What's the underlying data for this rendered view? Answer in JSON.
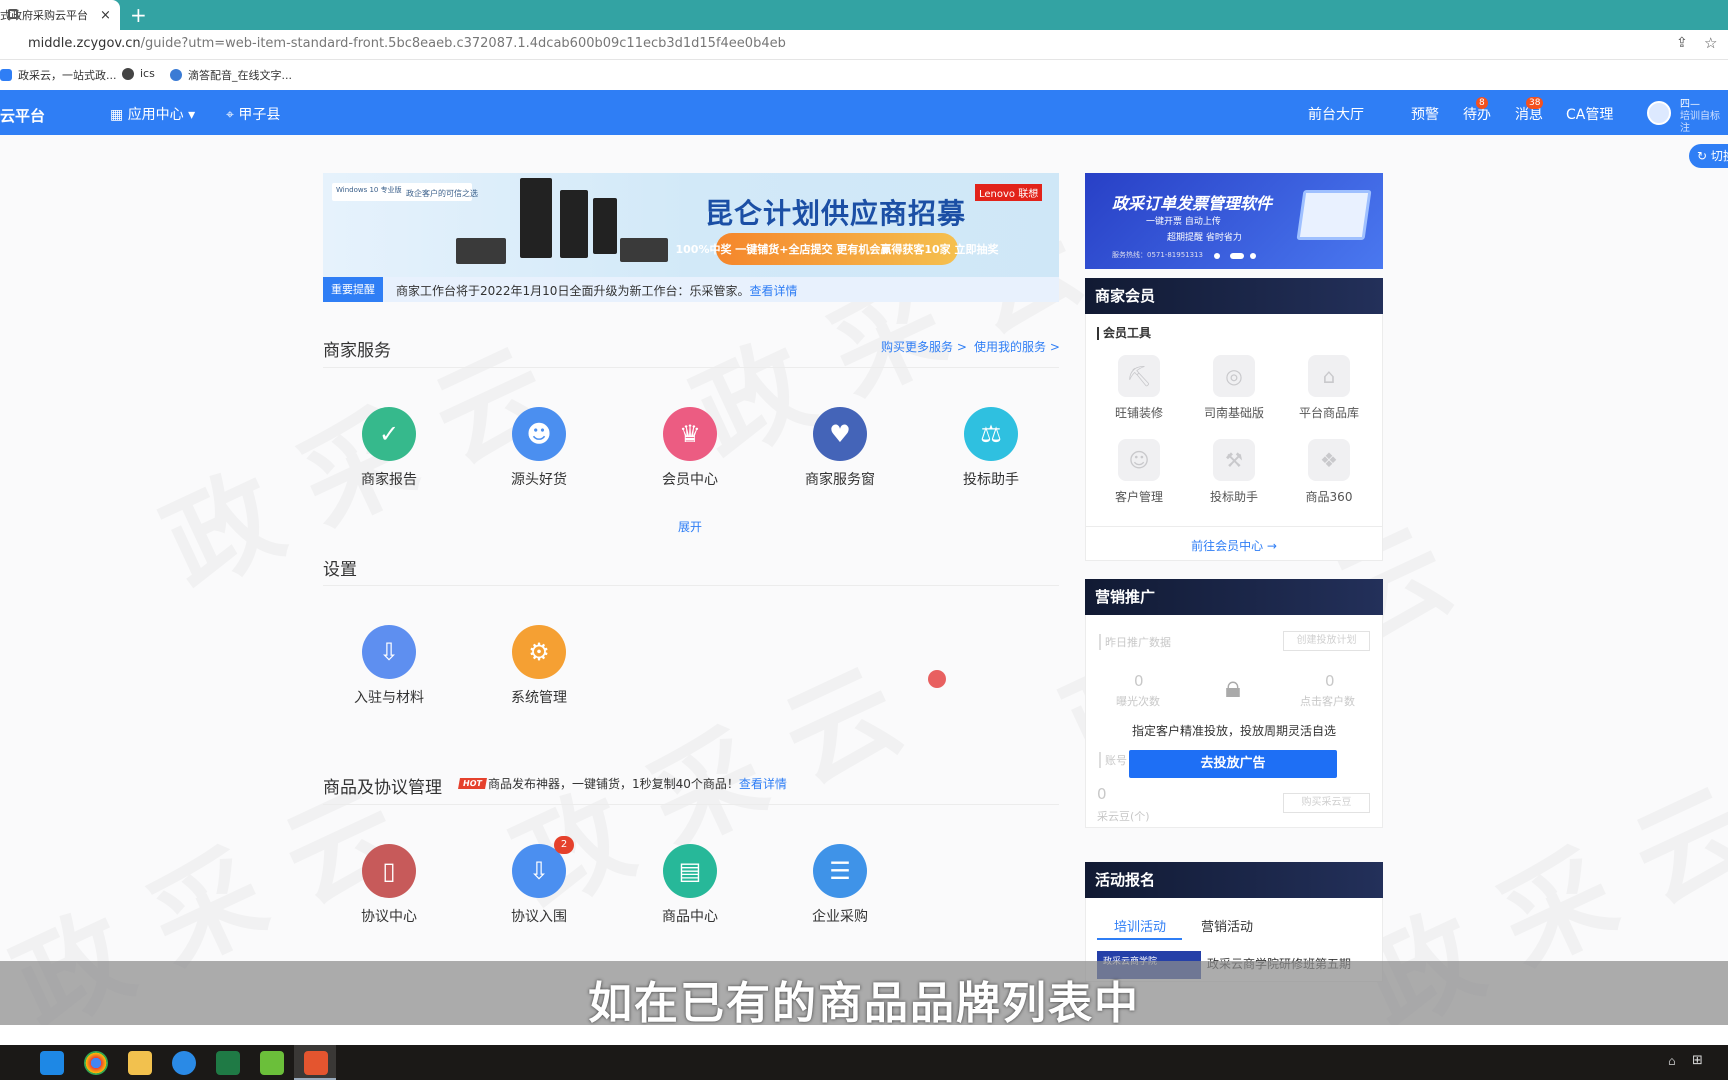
{
  "browser": {
    "tab_title": "式政府采购云平台",
    "tab_close": "×",
    "new_tab": "+",
    "url_host": "middle.zcygov.cn",
    "url_path": "/guide?utm=web-item-standard-front.5bc8eaeb.c372087.1.4dcab600b09c11ecb3d1d15f4ee0b4eb",
    "bookmarks": [
      "政采云，一站式政...",
      "ics",
      "滴答配音_在线文字..."
    ]
  },
  "header": {
    "brand": "云平台",
    "app_center": "应用中心",
    "location": "甲子县",
    "nav": {
      "front_hall": "前台大厅",
      "alert": "预警",
      "todo": "待办",
      "todo_badge": "8",
      "messages": "消息",
      "messages_badge": "38",
      "ca": "CA管理"
    },
    "user_name": "四—",
    "user_sub": "培训自标注",
    "switch": "切换"
  },
  "banner": {
    "logo_text": "Windows 10 专业版",
    "sub": "政企客户的可信之选",
    "title": "昆仑计划供应商招募",
    "brand": "Lenovo 联想",
    "pill": "100%中奖  一键铺货+全店提交 更有机会赢得获客10家  立即抽奖"
  },
  "notice": {
    "tag": "重要提醒",
    "text": "商家工作台将于2022年1月10日全面升级为新工作台：乐采管家。",
    "link": "查看详情"
  },
  "merchant_services": {
    "title": "商家服务",
    "buy_more": "购买更多服务 >",
    "my_services": "使用我的服务 >",
    "items": [
      {
        "label": "商家报告",
        "icon": "report-icon",
        "color": "#36b98c"
      },
      {
        "label": "源头好货",
        "icon": "users-icon",
        "color": "#4b8ff0"
      },
      {
        "label": "会员中心",
        "icon": "crown-icon",
        "color": "#ec5c82"
      },
      {
        "label": "商家服务窗",
        "icon": "shop-window-icon",
        "color": "#4464b8"
      },
      {
        "label": "投标助手",
        "icon": "bid-icon",
        "color": "#2fc0e0"
      }
    ],
    "expand": "展开"
  },
  "settings": {
    "title": "设置",
    "items": [
      {
        "label": "入驻与材料",
        "icon": "enter-icon",
        "color": "#5e8ff0"
      },
      {
        "label": "系统管理",
        "icon": "gear-icon",
        "color": "#f5a033"
      }
    ]
  },
  "goods": {
    "title": "商品及协议管理",
    "hot": "HOT",
    "promo": "商品发布神器，一键铺货，1秒复制40个商品！",
    "promo_link": "查看详情",
    "items": [
      {
        "label": "协议中心",
        "icon": "agreement-icon",
        "color": "#c75a5a",
        "badge": ""
      },
      {
        "label": "协议入围",
        "icon": "download-icon",
        "color": "#4b8ff0",
        "badge": "2"
      },
      {
        "label": "商品中心",
        "icon": "goods-icon",
        "color": "#27b899",
        "badge": ""
      },
      {
        "label": "企业采购",
        "icon": "cart-icon",
        "color": "#3f93e8",
        "badge": ""
      }
    ]
  },
  "ad": {
    "title": "政采订单发票管理软件",
    "line1": "一键开票 自动上传",
    "line2": "超期提醒 省时省力",
    "phone": "服务热线：0571-81951313"
  },
  "member": {
    "title": "商家会员",
    "tools_title": "会员工具",
    "tools": [
      "旺铺装修",
      "司南基础版",
      "平台商品库",
      "客户管理",
      "投标助手",
      "商品360"
    ],
    "goto": "前往会员中心 →"
  },
  "marketing": {
    "title": "营销推广",
    "yesterday": "昨日推广数据",
    "create_plan": "创建投放计划",
    "exposure_val": "0",
    "exposure": "曝光次数",
    "click_val": "0",
    "click": "点击客户数",
    "account": "账号",
    "beans_val": "0",
    "beans": "采云豆(个)",
    "buy_beans": "购买采云豆",
    "text": "指定客户精准投放，投放周期灵活自选",
    "button": "去投放广告"
  },
  "activity": {
    "title": "活动报名",
    "tabs": [
      "培训活动",
      "营销活动"
    ],
    "img_text": "政采云商学院",
    "item": "政采云商学院研修班第五期"
  },
  "subtitle": "如在已有的商品品牌列表中"
}
